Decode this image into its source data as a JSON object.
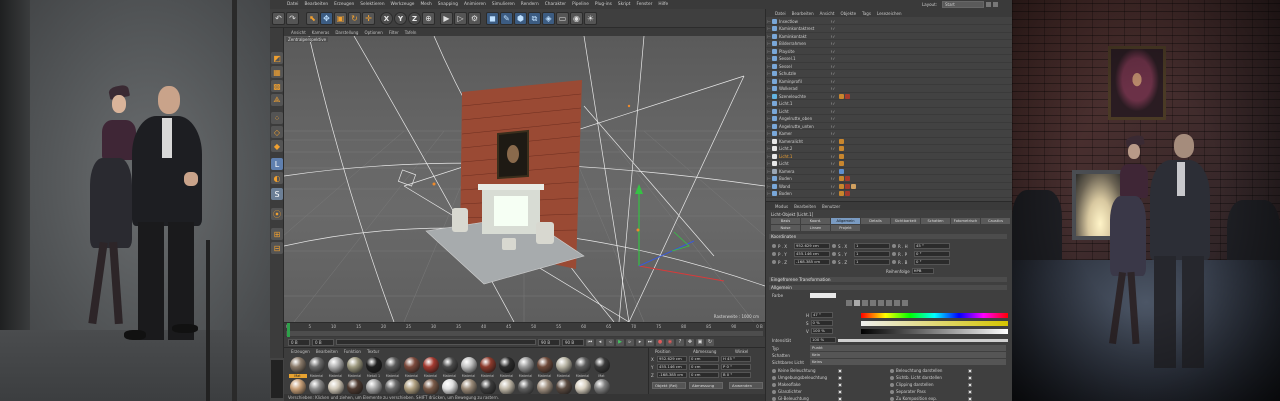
{
  "app": {
    "menu": [
      "Datei",
      "Bearbeiten",
      "Erzeugen",
      "Selektieren",
      "Werkzeuge",
      "Mesh",
      "Snapping",
      "Animieren",
      "Simulieren",
      "Rendern",
      "Charakter",
      "Pipeline",
      "Plug-ins",
      "Skript",
      "Fenster",
      "Hilfe"
    ],
    "layout_label": "Layout:",
    "layout_value": "Start"
  },
  "toolbar": {
    "axis_buttons": [
      "X",
      "Y",
      "Z"
    ]
  },
  "viewport": {
    "menu": [
      "Ansicht",
      "Kameras",
      "Darstellung",
      "Optionen",
      "Filter",
      "Tafeln"
    ],
    "label": "Zentralperspektive",
    "scale_text": "Rasterweite : 1000 cm"
  },
  "timeline": {
    "ticks": [
      "0",
      "5",
      "10",
      "15",
      "20",
      "25",
      "30",
      "35",
      "40",
      "45",
      "50",
      "55",
      "60",
      "65",
      "70",
      "75",
      "80",
      "85",
      "90"
    ],
    "frame_end_marker": "0 B",
    "start_field": "0 B",
    "current_field": "0 B",
    "end_field": "90 B",
    "max_field": "90 B"
  },
  "materials": {
    "menu": [
      "Erzeugen",
      "Bearbeiten",
      "Funktion",
      "Textur"
    ],
    "items": [
      {
        "label": "Mat",
        "color": "#8a7a6a",
        "sel": true
      },
      {
        "label": "Material",
        "color": "#6b6b6b"
      },
      {
        "label": "Material",
        "color": "#b0b0b0"
      },
      {
        "label": "Material",
        "color": "#9e9a80"
      },
      {
        "label": "Metall 1",
        "color": "#202020"
      },
      {
        "label": "Material",
        "color": "#5a5a5a"
      },
      {
        "label": "Material",
        "color": "#7c4a3c"
      },
      {
        "label": "Material",
        "color": "#a33a30"
      },
      {
        "label": "Material",
        "color": "#4a4a4a"
      },
      {
        "label": "Material",
        "color": "#c2c2c2"
      },
      {
        "label": "Material",
        "color": "#8c3a2c"
      },
      {
        "label": "Material",
        "color": "#2b2b2b"
      },
      {
        "label": "Material",
        "color": "#9a9a9a"
      },
      {
        "label": "Material",
        "color": "#6e4a3a"
      },
      {
        "label": "Material",
        "color": "#b8b4a4"
      },
      {
        "label": "Material",
        "color": "#5c5c5c"
      },
      {
        "label": "Mat",
        "color": "#3a3a3a"
      },
      {
        "label": "Mat",
        "color": "#c8a078"
      },
      {
        "label": "Mat",
        "color": "#8c8c8c"
      },
      {
        "label": "Mat",
        "color": "#d0c8b8"
      },
      {
        "label": "Mat",
        "color": "#4e3a30"
      },
      {
        "label": "Mat",
        "color": "#a8a8a8"
      },
      {
        "label": "Mat",
        "color": "#6a6a6a"
      },
      {
        "label": "Mat",
        "color": "#b0a080"
      },
      {
        "label": "Mat",
        "color": "#7a5a48"
      },
      {
        "label": "Mat",
        "color": "#e0e0e0"
      },
      {
        "label": "Mat",
        "color": "#9a8a78"
      },
      {
        "label": "Mat",
        "color": "#3c3c3c"
      },
      {
        "label": "Mat",
        "color": "#c0b8a8"
      },
      {
        "label": "Mat",
        "color": "#606060"
      },
      {
        "label": "Mat",
        "color": "#a09080"
      },
      {
        "label": "Mat",
        "color": "#5a4a40"
      },
      {
        "label": "Mat",
        "color": "#d8d0c0"
      },
      {
        "label": "Mat",
        "color": "#808080"
      }
    ]
  },
  "coords": {
    "head": [
      "Position",
      "Abmessung",
      "Winkel"
    ],
    "rows": [
      {
        "axis": "X",
        "pos": "952.629 cm",
        "size": "0 cm",
        "rot": "H  45 °"
      },
      {
        "axis": "Y",
        "pos": "455.146 cm",
        "size": "0 cm",
        "rot": "P  0 °"
      },
      {
        "axis": "Z",
        "pos": "-168.385 cm",
        "size": "0 cm",
        "rot": "B  0 °"
      }
    ],
    "mode": "Objekt (Rel)",
    "size_mode": "Abmessung",
    "apply": "Anwenden"
  },
  "objects": {
    "menu": [
      "Datei",
      "Bearbeiten",
      "Ansicht",
      "Objekte",
      "Tags",
      "Lesezeichen"
    ],
    "rows": [
      {
        "name": "Insectlow",
        "icon": "#79a7d8",
        "tags": []
      },
      {
        "name": "Kaminkontaktrest",
        "icon": "#79a7d8",
        "tags": []
      },
      {
        "name": "Kaminkontakt",
        "icon": "#79a7d8",
        "tags": []
      },
      {
        "name": "Bilderrahmen",
        "icon": "#79a7d8",
        "tags": []
      },
      {
        "name": "Playsite",
        "icon": "#79a7d8",
        "tags": []
      },
      {
        "name": "Sessel.1",
        "icon": "#79a7d8",
        "tags": []
      },
      {
        "name": "Sessel",
        "icon": "#79a7d8",
        "tags": []
      },
      {
        "name": "Schutzle",
        "icon": "#79a7d8",
        "tags": []
      },
      {
        "name": "Kaminprofil",
        "icon": "#79a7d8",
        "tags": []
      },
      {
        "name": "Wolkerad",
        "icon": "#79a7d8",
        "tags": []
      },
      {
        "name": "Szeneleuchte",
        "icon": "#62b3e0",
        "tags": [
          "#c8862e",
          "#a43a2c"
        ]
      },
      {
        "name": "Licht.1",
        "icon": "#79a7d8",
        "tags": []
      },
      {
        "name": "Licht",
        "icon": "#79a7d8",
        "tags": []
      },
      {
        "name": "Angelrutte_oben",
        "icon": "#79a7d8",
        "tags": []
      },
      {
        "name": "Angelrutte_unten",
        "icon": "#79a7d8",
        "tags": []
      },
      {
        "name": "Kamer",
        "icon": "#79a7d8",
        "tags": []
      },
      {
        "name": "Kameralicht",
        "icon": "#e8e8e8",
        "tags": [
          "#c8862e"
        ]
      },
      {
        "name": "Licht.2",
        "icon": "#e8e8e8",
        "tags": [
          "#c8862e"
        ]
      },
      {
        "name": "Licht.1",
        "icon": "#e8e8e8",
        "tags": [
          "#c8862e"
        ],
        "sel": true
      },
      {
        "name": "Licht",
        "icon": "#e8e8e8",
        "tags": [
          "#c8862e"
        ]
      },
      {
        "name": "Kamera",
        "icon": "#9aa6b4",
        "tags": [
          "#5f8fd0"
        ]
      },
      {
        "name": "Boden",
        "icon": "#79a7d8",
        "tags": [
          "#c8862e",
          "#a43a2c"
        ]
      },
      {
        "name": "Wand",
        "icon": "#79a7d8",
        "tags": [
          "#c8862e",
          "#a43a2c",
          "#d0a060"
        ]
      },
      {
        "name": "Boden",
        "icon": "#79a7d8",
        "tags": [
          "#c8862e",
          "#a43a2c"
        ]
      }
    ]
  },
  "attributes": {
    "menu": [
      "Modus",
      "Bearbeiten",
      "Benutzer"
    ],
    "title": "Licht-Objekt [Licht.1]",
    "tabs": [
      "Basis",
      "Koord.",
      "Allgemein",
      "Details",
      "Sichtbarkeit",
      "Schatten",
      "Fotometrisch",
      "Caustics",
      "Noise",
      "Linsen",
      "Projekt"
    ],
    "active_tab": "Allgemein",
    "coords_title": "Koordinaten",
    "coord_rows": [
      {
        "p": "P . X",
        "pv": "952.629 cm",
        "s": "S . X",
        "sv": "1",
        "r": "R . H",
        "rv": "45 °"
      },
      {
        "p": "P . Y",
        "pv": "455.146 cm",
        "s": "S . Y",
        "sv": "1",
        "r": "R . P",
        "rv": "0 °"
      },
      {
        "p": "P . Z",
        "pv": "-168.385 cm",
        "s": "S . Z",
        "sv": "1",
        "r": "R . B",
        "rv": "0 °"
      }
    ],
    "order_label": "Reihenfolge",
    "order_value": "HPB",
    "frozen_title": "Eingefrorene Transformation",
    "general_title": "Allgemein",
    "color_label": "Farbe",
    "h_label": "H",
    "h_value": "47 °",
    "s_label": "S",
    "s_value": "0 %",
    "v_label": "V",
    "v_value": "100 %",
    "intensity_label": "Intensität",
    "intensity_value": "100 %",
    "type_label": "Typ",
    "type_value": "Punkt",
    "shadow_label": "Schatten",
    "shadow_value": "Kein",
    "visible_light_label": "Sichtbares Licht",
    "visible_light_value": "Keins",
    "checks_left": [
      "Keine Beleuchtung",
      "Umgebungsbeleuchtung",
      "Makeoflake",
      "Glanzlichter",
      "GI-Beleuchtung"
    ],
    "checks_right": [
      "Beleuchtung darstellen",
      "Sichtb. Licht darstellen",
      "Clipping darstellen",
      "Separater Pass",
      "Zu Komposition exp."
    ]
  },
  "status": {
    "text": "Verschieben: Klicken und ziehen, um Elemente zu verschieben. SHIFT drücken, um Bewegung zu rastern."
  }
}
